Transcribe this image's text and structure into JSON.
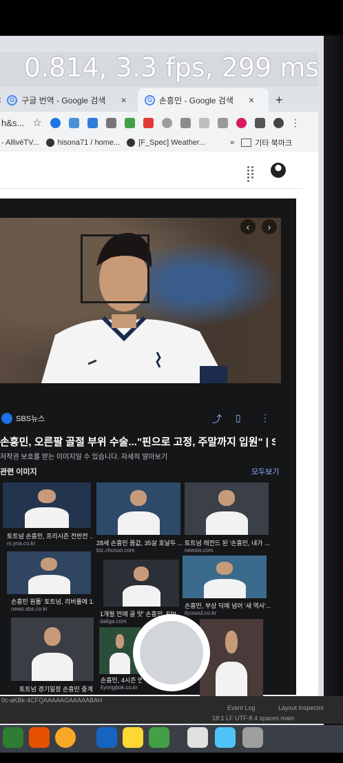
{
  "overlay": {
    "stats": "0.814, 3.3 fps, 299 ms"
  },
  "tabs": [
    {
      "label": "구글 번역 - Google 검색",
      "close": "×"
    },
    {
      "label": "손흥민 - Google 검색",
      "close": "×"
    }
  ],
  "new_tab": "+",
  "address": {
    "text": "h&s..."
  },
  "bookmarks": [
    {
      "label": "- AllivéTV..."
    },
    {
      "label": "hisona71 / home..."
    },
    {
      "label": "[F_Spec] Weather..."
    },
    {
      "label": "»"
    },
    {
      "label": "기타 북마크"
    }
  ],
  "viewer": {
    "source": "SBS뉴스",
    "title": "손흥민, 오른팔 골절 부위 수술...\"핀으로 고정, 주말까지 입원\" | SB...",
    "subtitle": "저작권 보호를 받는 이미지일 수 있습니다.  자세히 알아보기",
    "related_label": "관련 이미지",
    "more_label": "모두보기"
  },
  "related": [
    {
      "caption": "토트넘 손흥민, 프리시즌 전반전 ...",
      "source": "m.yna.co.kr"
    },
    {
      "caption": "28세 손흥민 몸값, 35살 호날두 ...",
      "source": "biz.chosun.com"
    },
    {
      "caption": "토트넘 레전드 된 '손흥민, 내가 ...",
      "source": "newsis.com"
    },
    {
      "caption": "손흥민 원톱' 토트넘, 리버풀에 1...",
      "source": "news.sbs.co.kr"
    },
    {
      "caption": "1개월 만에 골 맛' 손흥민, EPL ...",
      "source": "dailga.com"
    },
    {
      "caption": "손흥민, 부상 딕에 넘어 '새 역사'...",
      "source": "ilyosoul.co.kr"
    },
    {
      "caption": "토트넘 경기일정 손흥민 중계",
      "source": ""
    },
    {
      "caption": "손흥민, 4시즌 연속...",
      "source": "kyongbok.co.kr"
    },
    {
      "caption": "",
      "source": ""
    }
  ],
  "ide": {
    "path": "0c-aKBk-4CFQAAAAAGAAAAABAH",
    "event_log": "Event Log",
    "layout_inspector": "Layout Inspector",
    "status": "18:1   LF   UTF-8   4 spaces   main"
  },
  "colors": {
    "link": "#8ab4f8",
    "viewer_bg": "#151618",
    "chrome_bg": "#f1f3f4"
  }
}
